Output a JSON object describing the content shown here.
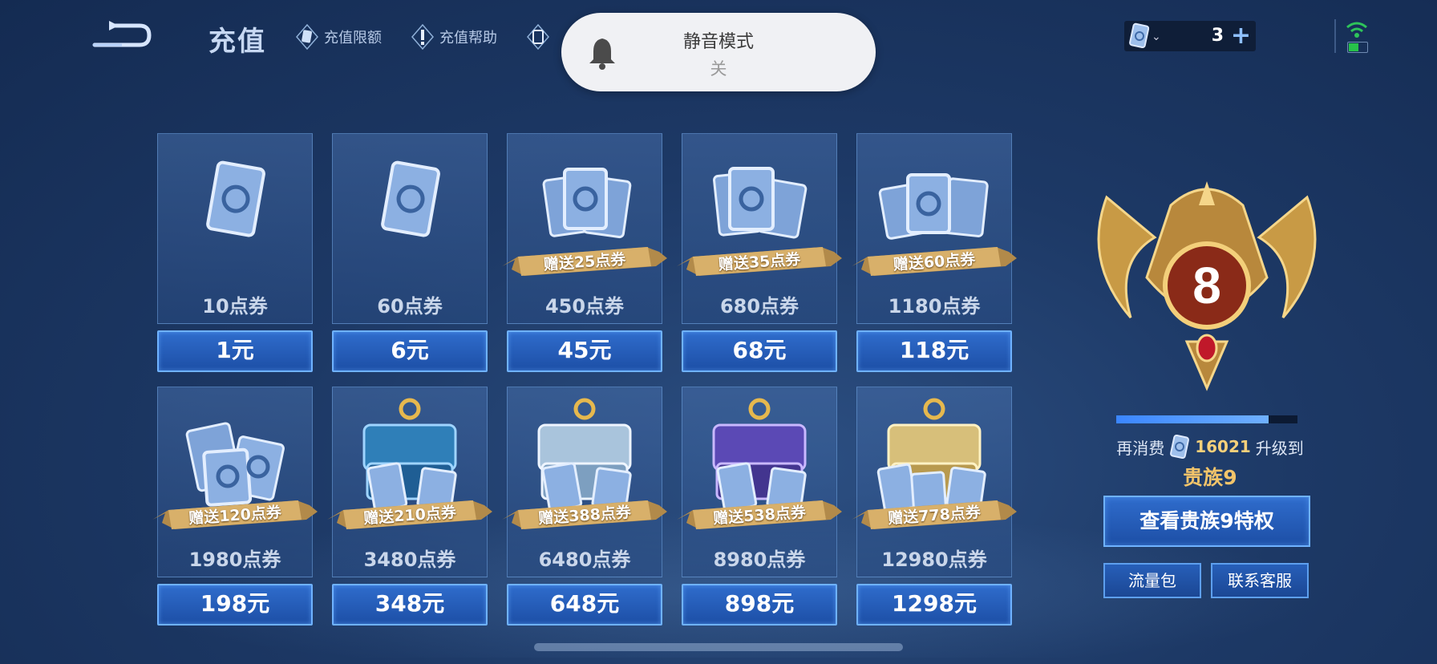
{
  "header": {
    "title": "充值",
    "links": [
      {
        "label": "充值限额"
      },
      {
        "label": "充值帮助"
      }
    ]
  },
  "toast": {
    "title": "静音模式",
    "status": "关"
  },
  "currency": {
    "count": "3",
    "plus": "+"
  },
  "packs": [
    {
      "points": "10点券",
      "price": "1元",
      "bonus": ""
    },
    {
      "points": "60点券",
      "price": "6元",
      "bonus": ""
    },
    {
      "points": "450点券",
      "price": "45元",
      "bonus": "赠送25点券"
    },
    {
      "points": "680点券",
      "price": "68元",
      "bonus": "赠送35点券"
    },
    {
      "points": "1180点券",
      "price": "118元",
      "bonus": "赠送60点券"
    },
    {
      "points": "1980点券",
      "price": "198元",
      "bonus": "赠送120点券"
    },
    {
      "points": "3480点券",
      "price": "348元",
      "bonus": "赠送210点券"
    },
    {
      "points": "6480点券",
      "price": "648元",
      "bonus": "赠送388点券"
    },
    {
      "points": "8980点券",
      "price": "898元",
      "bonus": "赠送538点券"
    },
    {
      "points": "12980点券",
      "price": "1298元",
      "bonus": "赠送778点券"
    }
  ],
  "noble": {
    "level": "8",
    "progress": 0.84,
    "prefix": "再消费",
    "amount": "16021",
    "suffix": "升级到",
    "next_level": "贵族9",
    "view_button": "查看贵族9特权",
    "traffic_button": "流量包",
    "support_button": "联系客服"
  },
  "colors": {
    "accent_blue": "#2f6ccc",
    "gold": "#f2c46a",
    "background": "#1d3966"
  }
}
